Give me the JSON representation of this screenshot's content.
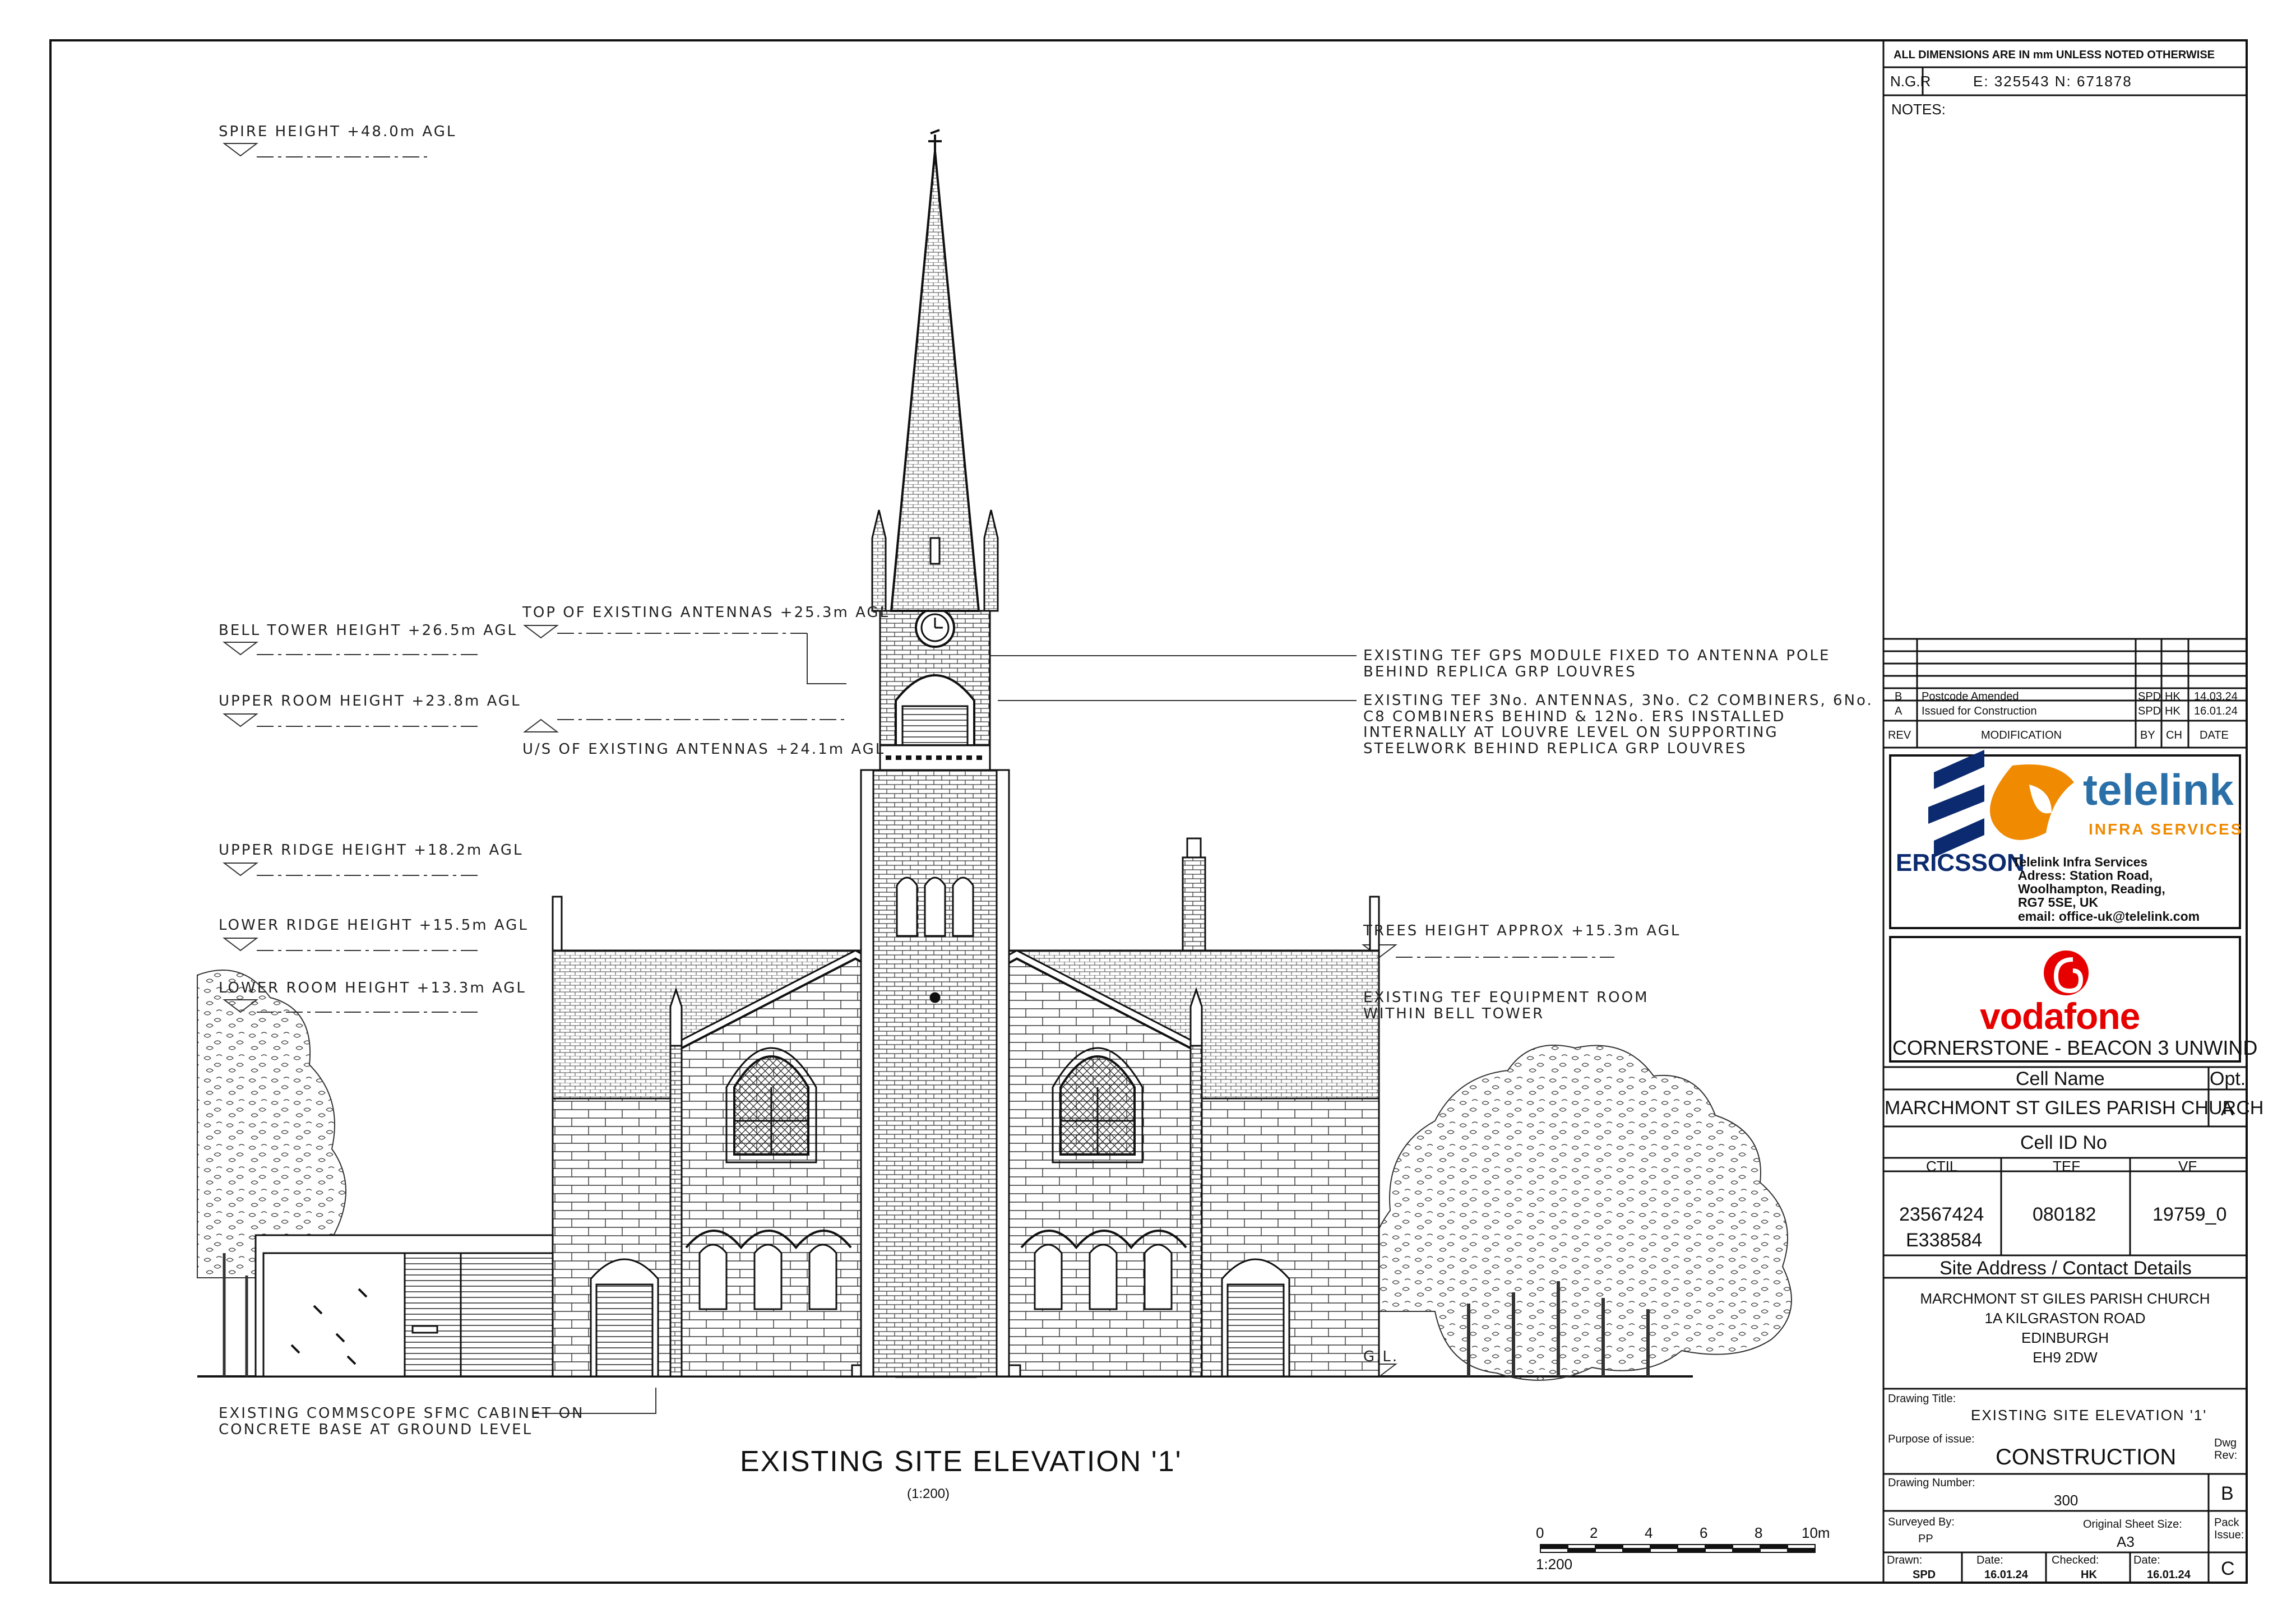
{
  "drawing": {
    "title": "EXISTING SITE ELEVATION '1'",
    "scale": "(1:200)",
    "scale_bar": {
      "ticks": [
        "0",
        "2",
        "4",
        "6",
        "8",
        "10m"
      ],
      "label": "1:200"
    }
  },
  "levels": [
    {
      "id": "spire",
      "text": "SPIRE HEIGHT +48.0m AGL"
    },
    {
      "id": "bell",
      "text": "BELL TOWER HEIGHT +26.5m AGL"
    },
    {
      "id": "upper-room",
      "text": "UPPER ROOM HEIGHT +23.8m AGL"
    },
    {
      "id": "upper-ridge",
      "text": "UPPER RIDGE HEIGHT +18.2m AGL"
    },
    {
      "id": "lower-ridge",
      "text": "LOWER RIDGE HEIGHT +15.5m AGL"
    },
    {
      "id": "lower-room",
      "text": "LOWER ROOM HEIGHT +13.3m AGL"
    },
    {
      "id": "ant-top",
      "text": "TOP OF EXISTING ANTENNAS +25.3m AGL"
    },
    {
      "id": "ant-us",
      "text": "U/S OF EXISTING ANTENNAS +24.1m AGL"
    },
    {
      "id": "trees",
      "text": "TREES HEIGHT APPROX +15.3m AGL"
    },
    {
      "id": "gl",
      "text": "G.L."
    }
  ],
  "notes": {
    "gps": [
      "EXISTING TEF GPS MODULE FIXED TO ANTENNA POLE",
      "BEHIND REPLICA GRP LOUVRES"
    ],
    "antennas": [
      "EXISTING TEF 3No. ANTENNAS, 3No. C2 COMBINERS, 6No.",
      "C8 COMBINERS BEHIND & 12No. ERS INSTALLED",
      "INTERNALLY AT LOUVRE LEVEL ON SUPPORTING",
      "STEELWORK BEHIND REPLICA GRP LOUVRES"
    ],
    "equipment": [
      "EXISTING TEF EQUIPMENT ROOM",
      "WITHIN BELL TOWER"
    ],
    "cabinet": [
      "EXISTING COMMSCOPE SFMC CABINET ON",
      "CONCRETE BASE AT GROUND LEVEL"
    ]
  },
  "title_block": {
    "dims_note": "ALL DIMENSIONS ARE IN mm UNLESS NOTED OTHERWISE",
    "ngr_label": "N.G.R",
    "ngr_value": "E: 325543   N: 671878",
    "notes_label": "NOTES:",
    "revisions": [
      {
        "rev": "B",
        "mod": "Postcode Amended",
        "by": "SPD",
        "ch": "HK",
        "date": "14.03.24"
      },
      {
        "rev": "A",
        "mod": "Issued for Construction",
        "by": "SPD",
        "ch": "HK",
        "date": "16.01.24"
      }
    ],
    "rev_headers": {
      "rev": "REV",
      "mod": "MODIFICATION",
      "by": "BY",
      "ch": "CH",
      "date": "DATE"
    },
    "ericsson": "ERICSSON",
    "telelink": "telelink",
    "telelink_sub": "INFRA SERVICES",
    "telelink_address": [
      "Telelink Infra Services",
      "Adress: Station Road,",
      "Woolhampton, Reading,",
      "RG7 5SE, UK",
      "email: office-uk@telelink.com"
    ],
    "vodafone": "vodafone",
    "project": "CORNERSTONE - BEACON 3 UNWIND",
    "cell_name_label": "Cell Name",
    "opt_label": "Opt.",
    "cell_name": "MARCHMONT ST GILES PARISH CHURCH",
    "opt": "A",
    "cell_id_label": "Cell ID No",
    "ctil_label": "CTIL",
    "tef_label": "TEF",
    "vf_label": "VF",
    "ctil": [
      "23567424",
      "E338584"
    ],
    "tef": "080182",
    "vf": "19759_0",
    "site_label": "Site Address / Contact Details",
    "address": [
      "MARCHMONT ST GILES PARISH CHURCH",
      "1A KILGRASTON ROAD",
      "EDINBURGH",
      "EH9 2DW"
    ],
    "dt_label": "Drawing Title:",
    "dt_value": "EXISTING SITE ELEVATION '1'",
    "purpose_label": "Purpose of issue:",
    "purpose": "CONSTRUCTION",
    "dwg_rev_label": "Dwg\nRev:",
    "dwg_num_label": "Drawing Number:",
    "dwg_num": "300",
    "dwg_rev": "B",
    "surveyed_label": "Surveyed By:",
    "surveyed": "PP",
    "orig_size_label": "Original Sheet Size:",
    "orig_size": "A3",
    "pack_label": "Pack\nIssue:",
    "pack": "C",
    "drawn_label": "Drawn:",
    "drawn": "SPD",
    "date1_label": "Date:",
    "date1": "16.01.24",
    "checked_label": "Checked:",
    "checked": "HK",
    "date2_label": "Date:",
    "date2": "16.01.24"
  },
  "colors": {
    "line": "#111111",
    "vodafone_red": "#e60000",
    "telelink_blue": "#2a6fa8",
    "telelink_orange": "#f08a00",
    "ericsson_blue": "#0b2a6f"
  }
}
